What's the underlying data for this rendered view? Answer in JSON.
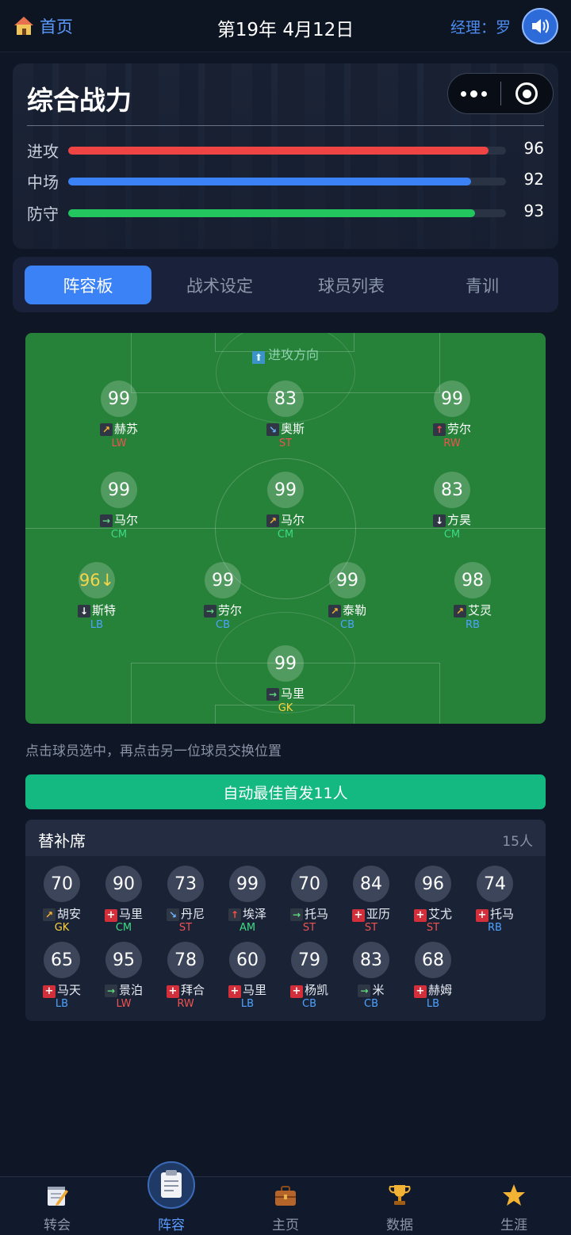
{
  "topbar": {
    "home_label": "首页",
    "date": "第19年 4月12日",
    "manager": "经理：罗"
  },
  "hero": {
    "title": "综合战力",
    "stats": [
      {
        "label": "进攻",
        "value": 96,
        "color": "#ef4444"
      },
      {
        "label": "中场",
        "value": 92,
        "color": "#3b82f6"
      },
      {
        "label": "防守",
        "value": 93,
        "color": "#22c55e"
      }
    ]
  },
  "tabs": [
    "阵容板",
    "战术设定",
    "球员列表",
    "青训"
  ],
  "pitch": {
    "attack_label": "进攻方向",
    "players": [
      {
        "rating": "99",
        "trend": "↗",
        "name": "赫苏",
        "pos": "LW"
      },
      {
        "rating": "83",
        "trend": "↘",
        "name": "奥斯",
        "pos": "ST"
      },
      {
        "rating": "99",
        "trend": "↑",
        "name": "劳尔",
        "pos": "RW"
      },
      {
        "rating": "99",
        "trend": "→",
        "name": "马尔",
        "pos": "CM"
      },
      {
        "rating": "99",
        "trend": "↗",
        "name": "马尔",
        "pos": "CM"
      },
      {
        "rating": "83",
        "trend": "↓",
        "name": "方昊",
        "pos": "CM"
      },
      {
        "rating": "96↓",
        "trend": "↓",
        "name": "斯特",
        "pos": "LB"
      },
      {
        "rating": "99",
        "trend": "→",
        "name": "劳尔",
        "pos": "CB"
      },
      {
        "rating": "99",
        "trend": "↗",
        "name": "泰勒",
        "pos": "CB"
      },
      {
        "rating": "98",
        "trend": "↗",
        "name": "艾灵",
        "pos": "RB"
      },
      {
        "rating": "99",
        "trend": "→",
        "name": "马里",
        "pos": "GK"
      }
    ]
  },
  "hint": "点击球员选中，再点击另一位球员交换位置",
  "auto_button": "自动最佳首发11人",
  "bench": {
    "title": "替补席",
    "count": "15人",
    "players": [
      {
        "rating": "70",
        "icon": "↗",
        "name": "胡安",
        "pos": "GK"
      },
      {
        "rating": "90",
        "icon": "+",
        "name": "马里",
        "pos": "CM"
      },
      {
        "rating": "73",
        "icon": "↘",
        "name": "丹尼",
        "pos": "ST"
      },
      {
        "rating": "99",
        "icon": "↑",
        "name": "埃泽",
        "pos": "AM"
      },
      {
        "rating": "70",
        "icon": "→",
        "name": "托马",
        "pos": "ST"
      },
      {
        "rating": "84",
        "icon": "+",
        "name": "亚历",
        "pos": "ST"
      },
      {
        "rating": "96",
        "icon": "+",
        "name": "艾尤",
        "pos": "ST"
      },
      {
        "rating": "74",
        "icon": "+",
        "name": "托马",
        "pos": "RB"
      },
      {
        "rating": "65",
        "icon": "+",
        "name": "马天",
        "pos": "LB"
      },
      {
        "rating": "95",
        "icon": "→",
        "name": "景泊",
        "pos": "LW"
      },
      {
        "rating": "78",
        "icon": "+",
        "name": "拜合",
        "pos": "RW"
      },
      {
        "rating": "60",
        "icon": "+",
        "name": "马里",
        "pos": "LB"
      },
      {
        "rating": "79",
        "icon": "+",
        "name": "杨凯",
        "pos": "CB"
      },
      {
        "rating": "83",
        "icon": "→",
        "name": "米",
        "pos": "CB"
      },
      {
        "rating": "68",
        "icon": "+",
        "name": "赫姆",
        "pos": "LB"
      }
    ]
  },
  "nav": [
    "转会",
    "阵容",
    "主页",
    "数据",
    "生涯"
  ]
}
